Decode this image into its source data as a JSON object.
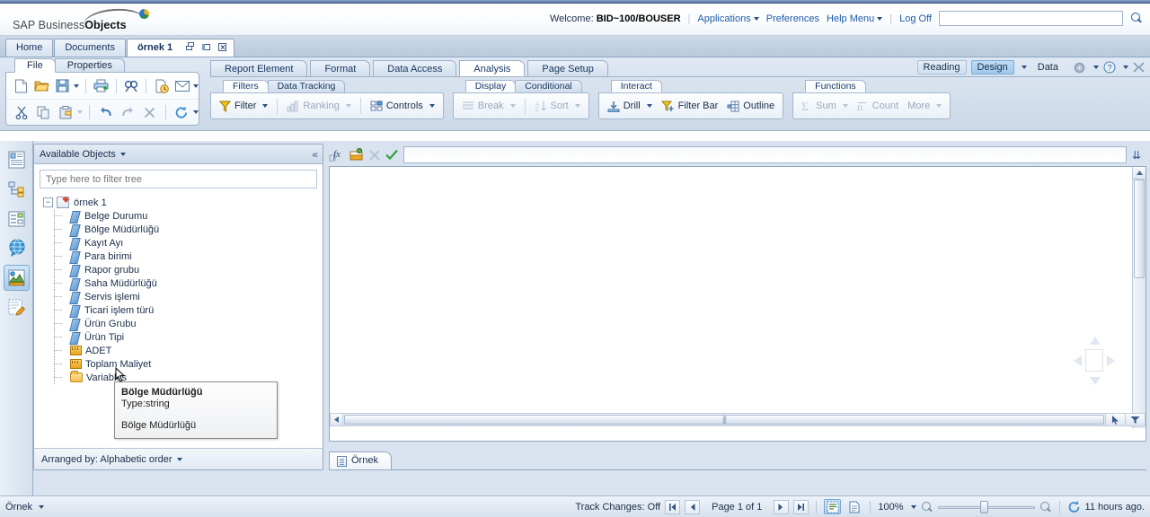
{
  "brand": {
    "name_light": "SAP Business",
    "name_bold": "Objects"
  },
  "header": {
    "welcome_label": "Welcome:",
    "user": "BID~100/BOUSER",
    "links": [
      {
        "label": "Applications",
        "caret": true
      },
      {
        "label": "Preferences",
        "caret": false
      },
      {
        "label": "Help Menu",
        "caret": true
      },
      {
        "label": "Log Off",
        "caret": false
      }
    ],
    "search_placeholder": "",
    "search_value": ""
  },
  "workspace_tabs": [
    {
      "label": "Home",
      "active": false
    },
    {
      "label": "Documents",
      "active": false
    },
    {
      "label": "örnek 1",
      "active": true
    }
  ],
  "file_pane": {
    "tabs": [
      {
        "label": "File",
        "active": true
      },
      {
        "label": "Properties",
        "active": false
      }
    ],
    "row1": [
      "new-document-icon",
      "open-folder-icon",
      "save-icon",
      "print-icon",
      "find-icon",
      "history-icon",
      "email-icon"
    ],
    "row2": [
      "cut-icon",
      "copy-icon",
      "paste-icon",
      "undo-icon",
      "redo-icon",
      "delete-icon",
      "refresh-icon"
    ]
  },
  "ribbon": {
    "tabs": [
      {
        "label": "Report Element",
        "active": false
      },
      {
        "label": "Format",
        "active": false
      },
      {
        "label": "Data Access",
        "active": false
      },
      {
        "label": "Analysis",
        "active": true
      },
      {
        "label": "Page Setup",
        "active": false
      }
    ],
    "groups": [
      {
        "name": "filters-group",
        "tabs": [
          {
            "label": "Filters",
            "active": true
          },
          {
            "label": "Data Tracking",
            "active": false
          }
        ],
        "items": [
          {
            "label": "Filter",
            "icon": "funnel-icon",
            "caret": true,
            "disabled": false
          },
          {
            "sep": true
          },
          {
            "label": "Ranking",
            "icon": "ranking-icon",
            "caret": true,
            "disabled": true
          },
          {
            "sep": true
          },
          {
            "label": "Controls",
            "icon": "controls-icon",
            "caret": true,
            "disabled": false
          }
        ]
      },
      {
        "name": "display-group",
        "tabs": [
          {
            "label": "Display",
            "active": true
          },
          {
            "label": "Conditional",
            "active": false
          }
        ],
        "items": [
          {
            "label": "Break",
            "icon": "break-icon",
            "caret": true,
            "disabled": true
          },
          {
            "sep": true
          },
          {
            "label": "Sort",
            "icon": "sort-icon",
            "caret": true,
            "disabled": true
          }
        ]
      },
      {
        "name": "interact-group",
        "tabs": [
          {
            "label": "Interact",
            "active": true
          }
        ],
        "items": [
          {
            "label": "Drill",
            "icon": "drill-icon",
            "caret": true,
            "disabled": false
          },
          {
            "label": "Filter Bar",
            "icon": "filter-bar-icon",
            "caret": false,
            "disabled": false
          },
          {
            "label": "Outline",
            "icon": "outline-icon",
            "caret": false,
            "disabled": false
          }
        ]
      },
      {
        "name": "functions-group",
        "tabs": [
          {
            "label": "Functions",
            "active": true
          }
        ],
        "items": [
          {
            "label": "Sum",
            "icon": "sigma-icon",
            "caret": true,
            "disabled": true
          },
          {
            "label": "Count",
            "icon": "count-icon",
            "caret": false,
            "disabled": true
          },
          {
            "label": "More",
            "icon": "",
            "caret": true,
            "disabled": true
          }
        ]
      }
    ],
    "modes": [
      {
        "label": "Reading",
        "state": "normal"
      },
      {
        "label": "Design",
        "state": "selected"
      },
      {
        "label": "Data",
        "state": "plain"
      }
    ]
  },
  "rail": [
    {
      "name": "document-summary-icon",
      "selected": false
    },
    {
      "name": "navigation-map-icon",
      "selected": false
    },
    {
      "name": "input-controls-icon",
      "selected": false
    },
    {
      "name": "web-service-icon",
      "selected": false
    },
    {
      "name": "available-objects-icon",
      "selected": true
    },
    {
      "name": "document-structure-icon",
      "selected": false
    }
  ],
  "panel": {
    "title": "Available Objects",
    "filter_placeholder": "Type here to filter tree",
    "filter_value": "",
    "collapse_glyph": "«",
    "root": {
      "label": "örnek 1",
      "icon": "query-icon",
      "expanded": true
    },
    "objects": [
      {
        "label": "Belge Durumu",
        "kind": "dimension"
      },
      {
        "label": "Bölge Müdürlüğü",
        "kind": "dimension"
      },
      {
        "label": "Kayıt Ayı",
        "kind": "dimension"
      },
      {
        "label": "Para birimi",
        "kind": "dimension"
      },
      {
        "label": "Rapor grubu",
        "kind": "dimension"
      },
      {
        "label": "Saha Müdürlüğü",
        "kind": "dimension"
      },
      {
        "label": "Servis işlemi",
        "kind": "dimension"
      },
      {
        "label": "Ticari işlem türü",
        "kind": "dimension"
      },
      {
        "label": "Ürün Grubu",
        "kind": "dimension"
      },
      {
        "label": "Ürün Tipi",
        "kind": "dimension"
      },
      {
        "label": "ADET",
        "kind": "measure"
      },
      {
        "label": "Toplam Maliyet",
        "kind": "measure"
      },
      {
        "label": "Variables",
        "kind": "folder"
      }
    ],
    "footer": {
      "label": "Arranged by: Alphabetic order"
    }
  },
  "tooltip": {
    "title": "Bölge Müdürlüğü",
    "type_line": "Type:string",
    "description": "Bölge Müdürlüğü"
  },
  "formula_bar": {
    "fx_icon": "formula-icon",
    "variable_icon": "create-variable-icon",
    "cancel_icon": "cancel-icon",
    "accept_icon": "validate-icon",
    "value": ""
  },
  "report_tabs": [
    {
      "label": "Örnek",
      "active": true
    }
  ],
  "status": {
    "report_selector": "Örnek",
    "track_changes": "Track Changes: Off",
    "page_label": "Page 1 of 1",
    "nav": [
      "first-page-icon",
      "previous-page-icon",
      "next-page-icon",
      "last-page-icon"
    ],
    "view_modes": [
      {
        "name": "quick-display-mode-icon",
        "selected": true
      },
      {
        "name": "page-mode-icon",
        "selected": false
      }
    ],
    "zoom_level": "100%",
    "last_refresh": "11 hours ago."
  }
}
